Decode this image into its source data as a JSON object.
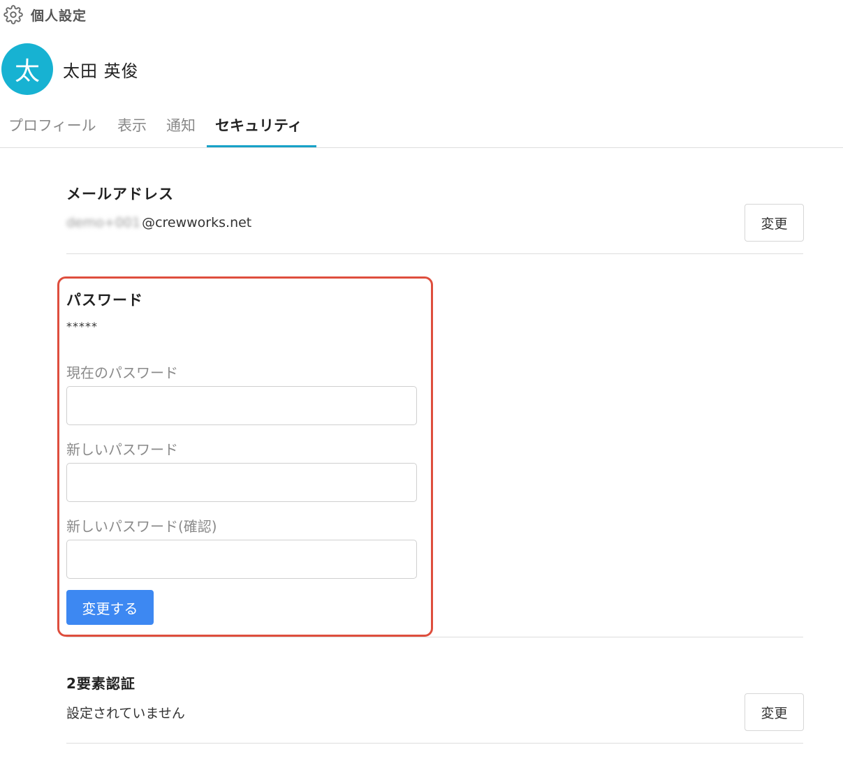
{
  "header": {
    "title": "個人設定",
    "icon": "gear-icon"
  },
  "user": {
    "avatar_initial": "太",
    "name": "太田 英俊",
    "avatar_color": "#17b2d2"
  },
  "tabs": [
    {
      "label": "プロフィール",
      "active": false
    },
    {
      "label": "表示",
      "active": false
    },
    {
      "label": "通知",
      "active": false
    },
    {
      "label": "セキュリティ",
      "active": true
    }
  ],
  "email": {
    "title": "メールアドレス",
    "value_blurred": "demo+001",
    "value_domain": "@crewworks.net",
    "change_label": "変更"
  },
  "password": {
    "title": "パスワード",
    "masked": "*****",
    "current_label": "現在のパスワード",
    "new_label": "新しいパスワード",
    "confirm_label": "新しいパスワード(確認)",
    "current_value": "",
    "new_value": "",
    "confirm_value": "",
    "submit_label": "変更する"
  },
  "two_factor": {
    "title": "2要素認証",
    "status": "設定されていません",
    "change_label": "変更"
  },
  "colors": {
    "accent": "#17a2c8",
    "primary_button": "#3d88f2",
    "highlight_border": "#de4e3d"
  }
}
